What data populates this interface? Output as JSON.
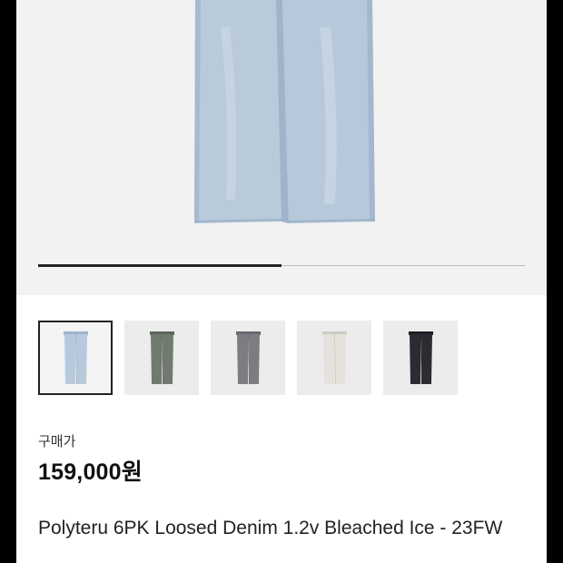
{
  "product": {
    "images_count_label": "",
    "gallery_progress": 0.5,
    "thumbnails": [
      {
        "name": "thumb-light-blue",
        "color": "#b7c9dc",
        "accent": "#9fb5cc",
        "selected": true
      },
      {
        "name": "thumb-khaki",
        "color": "#707a6e",
        "accent": "#5e675c",
        "selected": false
      },
      {
        "name": "thumb-gray",
        "color": "#7b7d83",
        "accent": "#67696f",
        "selected": false
      },
      {
        "name": "thumb-cream",
        "color": "#e4e2da",
        "accent": "#cfccc2",
        "selected": false
      },
      {
        "name": "thumb-black",
        "color": "#2a2c31",
        "accent": "#1c1d21",
        "selected": false
      }
    ],
    "price_label": "구매가",
    "price": "159,000원",
    "title": "Polyteru 6PK Loosed Denim 1.2v Bleached Ice - 23FW"
  },
  "colors": {
    "denim": "#b9cadb",
    "denim_shade": "#a6bbd0",
    "background": "#f2f2f2"
  }
}
